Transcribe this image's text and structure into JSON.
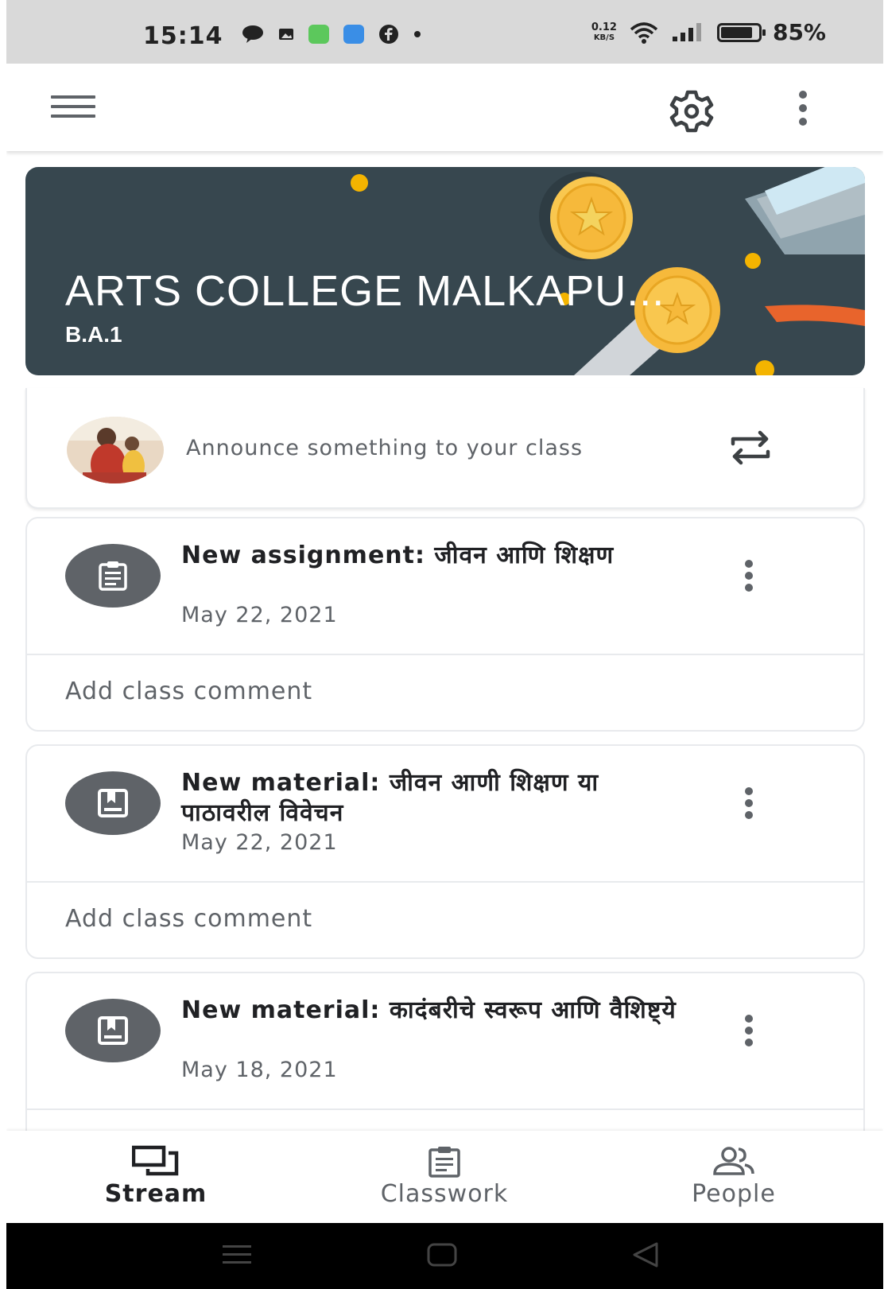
{
  "status_bar": {
    "time": "15:14",
    "net_speed_value": "0.12",
    "net_speed_unit": "KB/S",
    "battery_percent": "85%",
    "battery_level": 0.85
  },
  "app_bar": {
    "menu_icon": "menu-icon",
    "settings_icon": "gear-icon",
    "more_icon": "more-vert-icon"
  },
  "banner": {
    "class_name": "ARTS COLLEGE MALKAPU...",
    "section": "B.A.1",
    "background_color": "#37474f"
  },
  "announce": {
    "placeholder": "Announce something to your class",
    "repost_icon": "repost-icon"
  },
  "posts": [
    {
      "type_icon": "assignment-icon",
      "title": "New assignment: जीवन आणि शिक्षण",
      "date": "May 22, 2021",
      "comment_placeholder": "Add class comment"
    },
    {
      "type_icon": "material-icon",
      "title": "New material: जीवन आणी शिक्षण या पाठावरील विवेचन",
      "date": "May 22, 2021",
      "comment_placeholder": "Add class comment"
    },
    {
      "type_icon": "material-icon",
      "title": "New material: कादंबरीचे स्वरूप आणि वैशिष्ट्ये",
      "date": "May 18, 2021"
    }
  ],
  "bottom_nav": {
    "items": [
      {
        "label": "Stream",
        "icon": "stream-icon",
        "active": true
      },
      {
        "label": "Classwork",
        "icon": "classwork-icon",
        "active": false
      },
      {
        "label": "People",
        "icon": "people-icon",
        "active": false
      }
    ]
  },
  "colors": {
    "icon_grey": "#5f6368",
    "text_dark": "#202124",
    "banner_accent": "#f4b400"
  }
}
